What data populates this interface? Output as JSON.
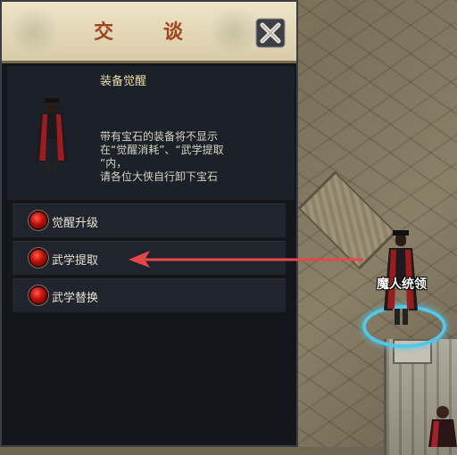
{
  "dialog": {
    "title": "交 谈",
    "section_title": "装备觉醒",
    "description_lines": [
      "带有宝石的装备将不显示",
      "在“觉醒消耗”、“武学提取",
      "”内，",
      "请各位大侠自行卸下宝石"
    ],
    "options": [
      {
        "label": "觉醒升级",
        "icon": "red-orb-icon"
      },
      {
        "label": "武学提取",
        "icon": "red-orb-icon"
      },
      {
        "label": "武学替换",
        "icon": "red-orb-icon"
      }
    ],
    "close_icon": "close-x-icon"
  },
  "world": {
    "npc_name": "魔人统领"
  },
  "colors": {
    "header_bg": "#e6dbbd",
    "title": "#a0441f",
    "panel_bg": "#14161c",
    "annotation_arrow": "#e8474a",
    "npc_ring": "#4fc8e9"
  }
}
